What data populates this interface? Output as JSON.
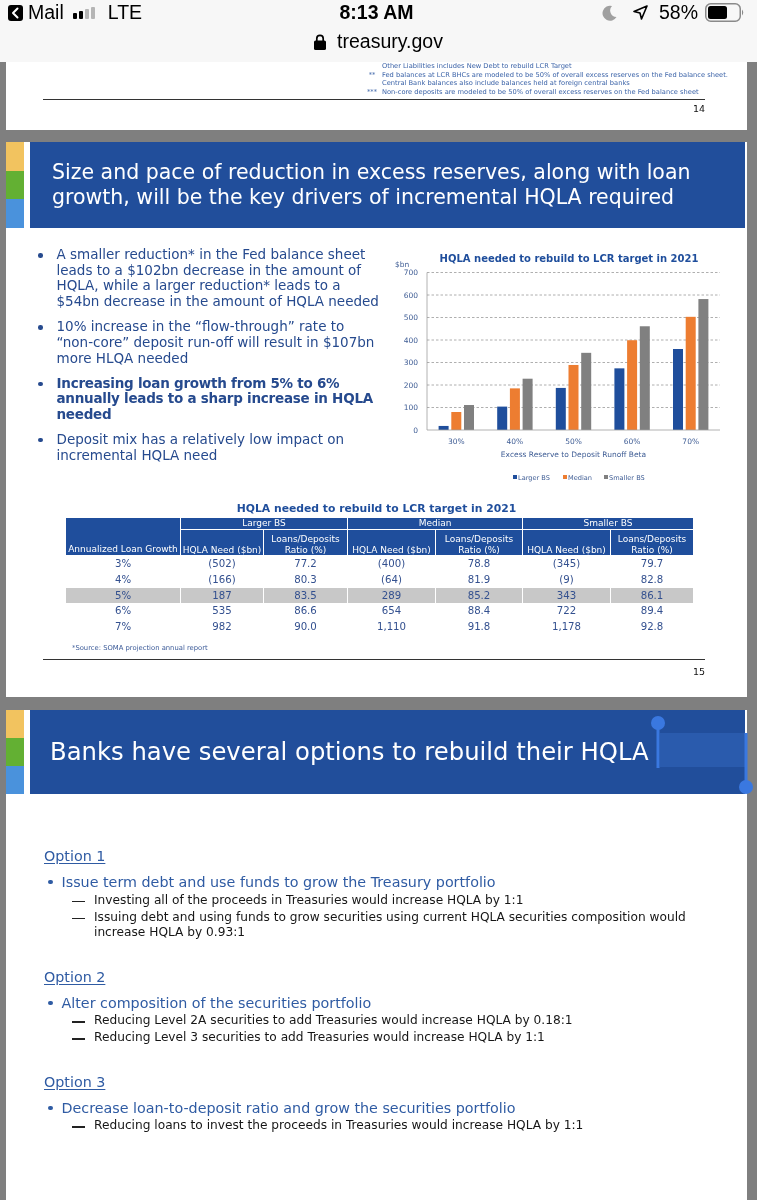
{
  "status_bar": {
    "back_label": "Mail",
    "network": "LTE",
    "time": "8:13 AM",
    "battery": "58%"
  },
  "address_bar": {
    "url": "treasury.gov"
  },
  "page_14": {
    "footnotes": [
      {
        "text": "Other Liabilities includes New Debt to rebuild LCR Target"
      },
      {
        "mark": "**",
        "text": "Fed balances at LCR BHCs are modeled to be 50% of overall excess reserves on the Fed balance sheet. Central Bank balances also include balances held at foreign central banks"
      },
      {
        "mark": "***",
        "text": "Non-core deposits are modeled to be 50% of overall excess reserves on the Fed balance sheet"
      }
    ],
    "page_number": "14"
  },
  "page_15": {
    "title": "Size and pace of reduction in excess reserves, along with loan growth, will be the key drivers of incremental HQLA required",
    "bullets": [
      {
        "text": "A smaller reduction* in the Fed balance sheet leads to a $102bn decrease in the amount of HQLA, while a larger reduction* leads to a $54bn decrease in the amount of HQLA needed",
        "emphasis": false
      },
      {
        "text": "10% increase in the “flow-through” rate to “non-core” deposit run-off will result in $107bn more HLQA needed",
        "emphasis": false
      },
      {
        "text": "Increasing loan growth from 5% to 6% annually leads to a sharp increase in HQLA needed",
        "emphasis": true
      },
      {
        "text": "Deposit mix has a relatively low impact on incremental HQLA need",
        "emphasis": false
      }
    ],
    "chart_data": {
      "type": "bar",
      "title": "HQLA needed to rebuild to LCR target in 2021",
      "xlabel": "Excess Reserve to Deposit Runoff Beta",
      "ylabel": "$bn",
      "categories": [
        "30%",
        "40%",
        "50%",
        "60%",
        "70%"
      ],
      "series": [
        {
          "name": "Larger BS",
          "color": "#1f4e9c",
          "values": [
            18,
            104,
            187,
            274,
            360
          ]
        },
        {
          "name": "Median",
          "color": "#ed7d31",
          "values": [
            80,
            185,
            289,
            399,
            503
          ]
        },
        {
          "name": "Smaller BS",
          "color": "#808080",
          "values": [
            111,
            228,
            343,
            461,
            582
          ]
        }
      ],
      "ylim": [
        0,
        700
      ],
      "yticks": [
        0,
        100,
        200,
        300,
        400,
        500,
        600,
        700
      ],
      "grid": true,
      "legend": "bottom"
    },
    "table": {
      "title": "HQLA needed to rebuild to LCR target in 2021",
      "groups": [
        "Larger BS",
        "Median",
        "Smaller BS"
      ],
      "columns": [
        "Annualized Loan Growth",
        "HQLA Need ($bn)",
        "Loans/Deposits Ratio (%)",
        "HQLA Need ($bn)",
        "Loans/Deposits Ratio (%)",
        "HQLA Need ($bn)",
        "Loans/Deposits Ratio (%)"
      ],
      "rows": [
        {
          "cells": [
            "3%",
            "(502)",
            "77.2",
            "(400)",
            "78.8",
            "(345)",
            "79.7"
          ],
          "highlighted": false
        },
        {
          "cells": [
            "4%",
            "(166)",
            "80.3",
            "(64)",
            "81.9",
            "(9)",
            "82.8"
          ],
          "highlighted": false
        },
        {
          "cells": [
            "5%",
            "187",
            "83.5",
            "289",
            "85.2",
            "343",
            "86.1"
          ],
          "highlighted": true
        },
        {
          "cells": [
            "6%",
            "535",
            "86.6",
            "654",
            "88.4",
            "722",
            "89.4"
          ],
          "highlighted": false
        },
        {
          "cells": [
            "7%",
            "982",
            "90.0",
            "1,110",
            "91.8",
            "1,178",
            "92.8"
          ],
          "highlighted": false
        }
      ]
    },
    "source_note": "*Source: SOMA projection annual report",
    "page_number": "15"
  },
  "page_16": {
    "title": "Banks have several options to rebuild their HQLA",
    "text_selection": true,
    "options": [
      {
        "heading": "Option 1",
        "items": [
          {
            "text": "Issue term debt and use funds to grow the Treasury portfolio",
            "children": [
              {
                "text": "Investing all of the proceeds in Treasuries would increase HQLA by 1:1"
              },
              {
                "text": "Issuing debt and using funds to grow securities using current HQLA securities composition would increase HQLA by 0.93:1"
              }
            ]
          }
        ]
      },
      {
        "heading": "Option 2",
        "items": [
          {
            "text": "Alter composition of the securities portfolio",
            "children": [
              {
                "text": "Reducing Level 2A securities to add Treasuries would increase HQLA by 0.18:1"
              },
              {
                "text": "Reducing Level 3 securities to add Treasuries would increase HQLA by 1:1"
              }
            ]
          }
        ]
      },
      {
        "heading": "Option 3",
        "items": [
          {
            "text": "Decrease loan-to-deposit ratio and grow the securities portfolio",
            "children": [
              {
                "text": "Reducing loans to invest the proceeds in Treasuries would increase HQLA by 1:1"
              }
            ]
          }
        ]
      }
    ]
  }
}
